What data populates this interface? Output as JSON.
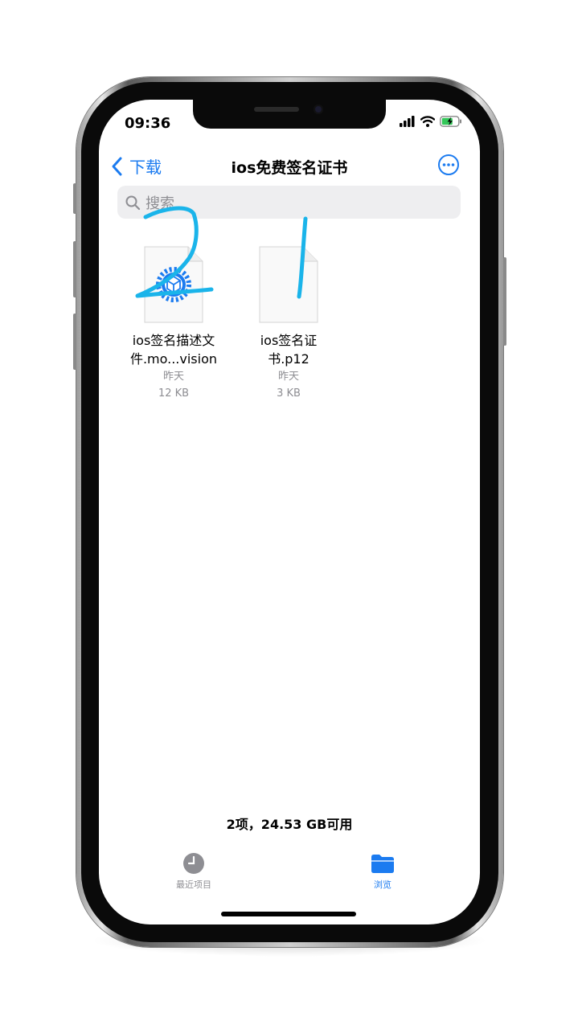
{
  "status_bar": {
    "time": "09:36"
  },
  "nav": {
    "back_label": "下载",
    "title": "ios免费签名证书"
  },
  "search": {
    "placeholder": "搜索"
  },
  "files": [
    {
      "name_line1": "ios签名描述文",
      "name_line2": "件.mo...vision",
      "date": "昨天",
      "size": "12 KB",
      "icon": "gear-profile-icon"
    },
    {
      "name_line1": "ios签名证",
      "name_line2": "书.p12",
      "date": "昨天",
      "size": "3 KB",
      "icon": "blank-document-icon"
    }
  ],
  "footer": {
    "info": "2项，24.53 GB可用"
  },
  "tabs": [
    {
      "label": "最近项目",
      "icon": "clock-icon",
      "active": false
    },
    {
      "label": "浏览",
      "icon": "folder-icon",
      "active": true
    }
  ],
  "colors": {
    "accent": "#1b7bf0",
    "annotation": "#1ab4ea",
    "inactive": "#8e8e93"
  }
}
